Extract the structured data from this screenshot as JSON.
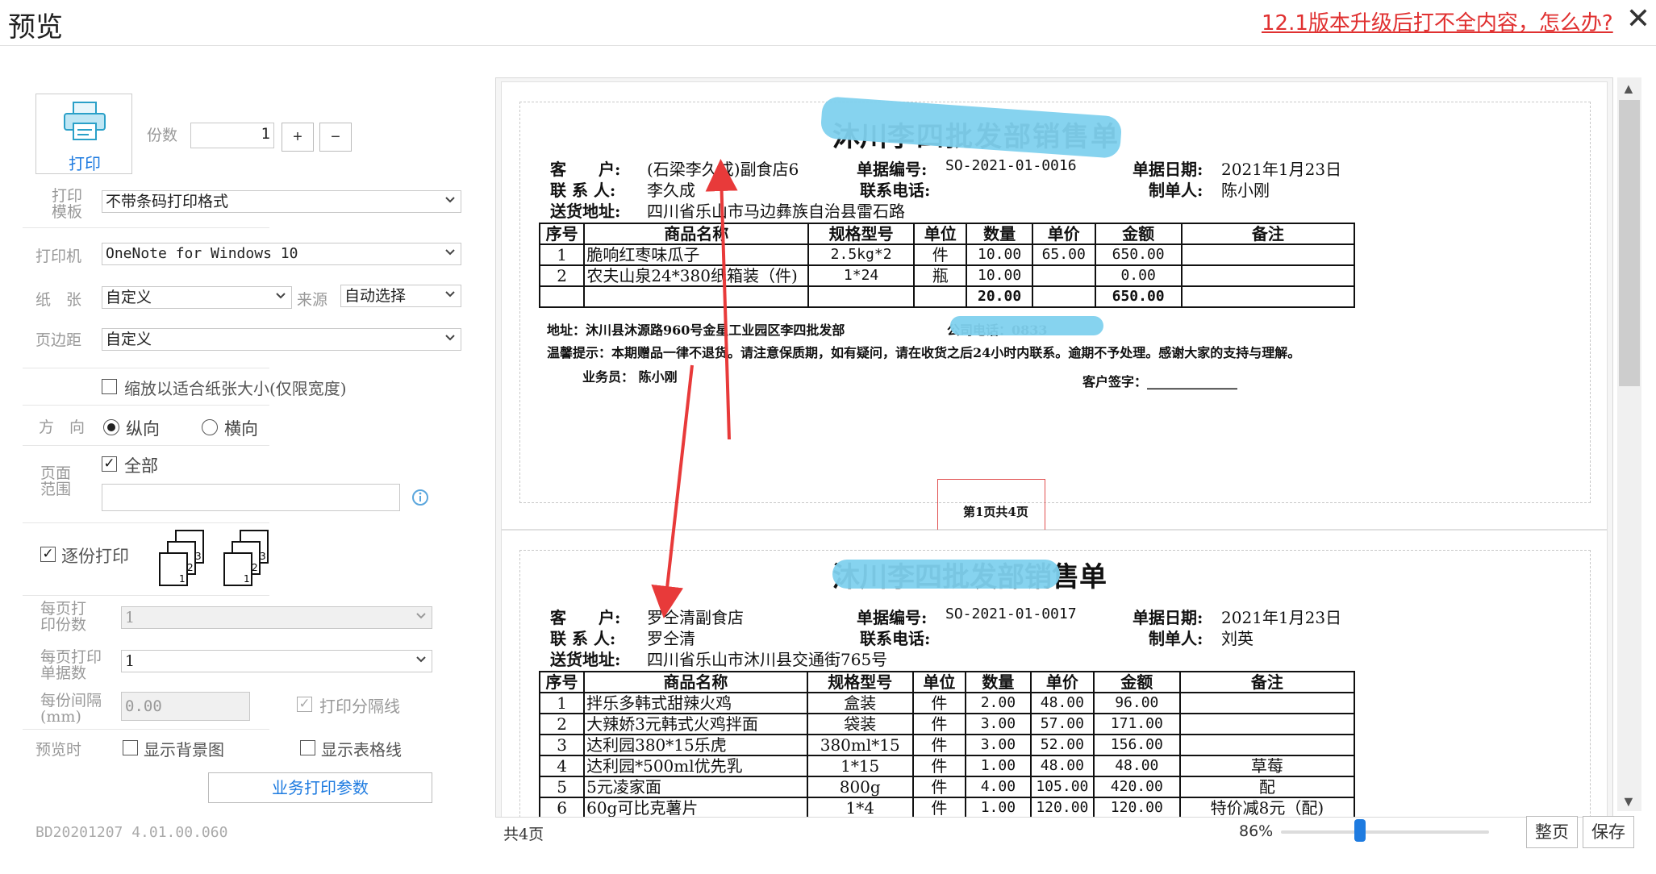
{
  "window": {
    "title": "预览",
    "help_link": "12.1版本升级后打不全内容，怎么办?",
    "close_glyph": "✕"
  },
  "left": {
    "print_button": "打印",
    "copies_label": "份数",
    "copies_value": "1",
    "plus": "+",
    "minus": "−",
    "template_label_1": "打印",
    "template_label_2": "模板",
    "template_value": "不带条码打印格式",
    "printer_label": "打印机",
    "printer_value": "OneNote for Windows 10",
    "paper_label": "纸　张",
    "paper_value": "自定义",
    "source_label": "来源",
    "source_value": "自动选择",
    "margin_label": "页边距",
    "margin_value": "自定义",
    "fit_label": "缩放以适合纸张大小(仅限宽度)",
    "direction_label": "方　向",
    "portrait": "纵向",
    "landscape": "横向",
    "range_label_1": "页面",
    "range_label_2": "范围",
    "range_all": "全部",
    "range_value": "",
    "collate_label": "逐份打印",
    "per_page_copies_1": "每页打",
    "per_page_copies_2": "印份数",
    "per_page_copies_value": "1",
    "per_page_docs_1": "每页打印",
    "per_page_docs_2": "单据数",
    "per_page_docs_value": "1",
    "gap_1": "每份间隔",
    "gap_2": "(mm)",
    "gap_value": "0.00",
    "print_divider": "打印分隔线",
    "preview_label": "预览时",
    "show_bg": "显示背景图",
    "show_grid": "显示表格线",
    "biz_params": "业务打印参数",
    "version": "BD20201207 4.01.00.060"
  },
  "doc1": {
    "title_tail": "沐川",
    "cust_label": "客　　户:",
    "cust": "(石梁李久成)副食店6",
    "no_label": "单据编号:",
    "no": "SO-2021-01-0016",
    "date_label": "单据日期:",
    "date": "2021年1月23日",
    "contact_label": "联 系 人:",
    "contact": "李久成",
    "phone_label": "联系电话:",
    "maker_label": "制单人:",
    "maker": "陈小刚",
    "addr_label": "送货地址:",
    "addr": "四川省乐山市马边彝族自治县雷石路",
    "headers": [
      "序号",
      "商品名称",
      "规格型号",
      "单位",
      "数量",
      "单价",
      "金额",
      "备注"
    ],
    "rows": [
      [
        "1",
        "脆响红枣味瓜子",
        "2.5kg*2",
        "件",
        "10.00",
        "65.00",
        "650.00",
        ""
      ],
      [
        "2",
        "农夫山泉24*380纸箱装（件)",
        "1*24",
        "瓶",
        "10.00",
        "",
        "0.00",
        ""
      ]
    ],
    "total_qty": "20.00",
    "total_amt": "650.00",
    "footer_addr": "地址：沐川县沐源路960号金星工业园区李四批发部",
    "footer_phone": "公司电话：0833",
    "tip": "温馨提示：本期赠品一律不退货。请注意保质期，如有疑问，请在收货之后24小时内联系。逾期不予处理。感谢大家的支持与理解。",
    "salesman": "业务员：  陈小刚",
    "signature": "客户签字：______________",
    "page_label": "第1页共4页"
  },
  "doc2": {
    "title": "沐川李四批发部销售单",
    "cust": "罗仝清副食店",
    "no": "SO-2021-01-0017",
    "date": "2021年1月23日",
    "contact": "罗仝清",
    "maker": "刘英",
    "addr": "四川省乐山市沐川县交通街765号",
    "rows": [
      [
        "1",
        "拌乐多韩式甜辣火鸡",
        "盒装",
        "件",
        "2.00",
        "48.00",
        "96.00",
        ""
      ],
      [
        "2",
        "大辣娇3元韩式火鸡拌面",
        "袋装",
        "件",
        "3.00",
        "57.00",
        "171.00",
        ""
      ],
      [
        "3",
        "达利园380*15乐虎",
        "380ml*15",
        "件",
        "3.00",
        "52.00",
        "156.00",
        ""
      ],
      [
        "4",
        "达利园*500ml优先乳",
        "1*15",
        "件",
        "1.00",
        "48.00",
        "48.00",
        "草莓"
      ],
      [
        "5",
        "5元凌家面",
        "800g",
        "件",
        "4.00",
        "105.00",
        "420.00",
        "配"
      ],
      [
        "6",
        "60g可比克薯片",
        "1*4",
        "件",
        "1.00",
        "120.00",
        "120.00",
        "特价减8元（配)"
      ]
    ]
  },
  "bottom": {
    "page_count": "共4页",
    "zoom": "86%",
    "zoom_fraction": 0.38,
    "fit_page": "整页",
    "save": "保存"
  },
  "colors": {
    "accent": "#1e7be0",
    "link": "#e03030",
    "highlight": "#7fd1ee",
    "arrow": "#e83a3a"
  },
  "icons": [
    "printer-icon",
    "close-icon",
    "chevron-down-icon",
    "info-icon",
    "collate-pages-icon"
  ]
}
